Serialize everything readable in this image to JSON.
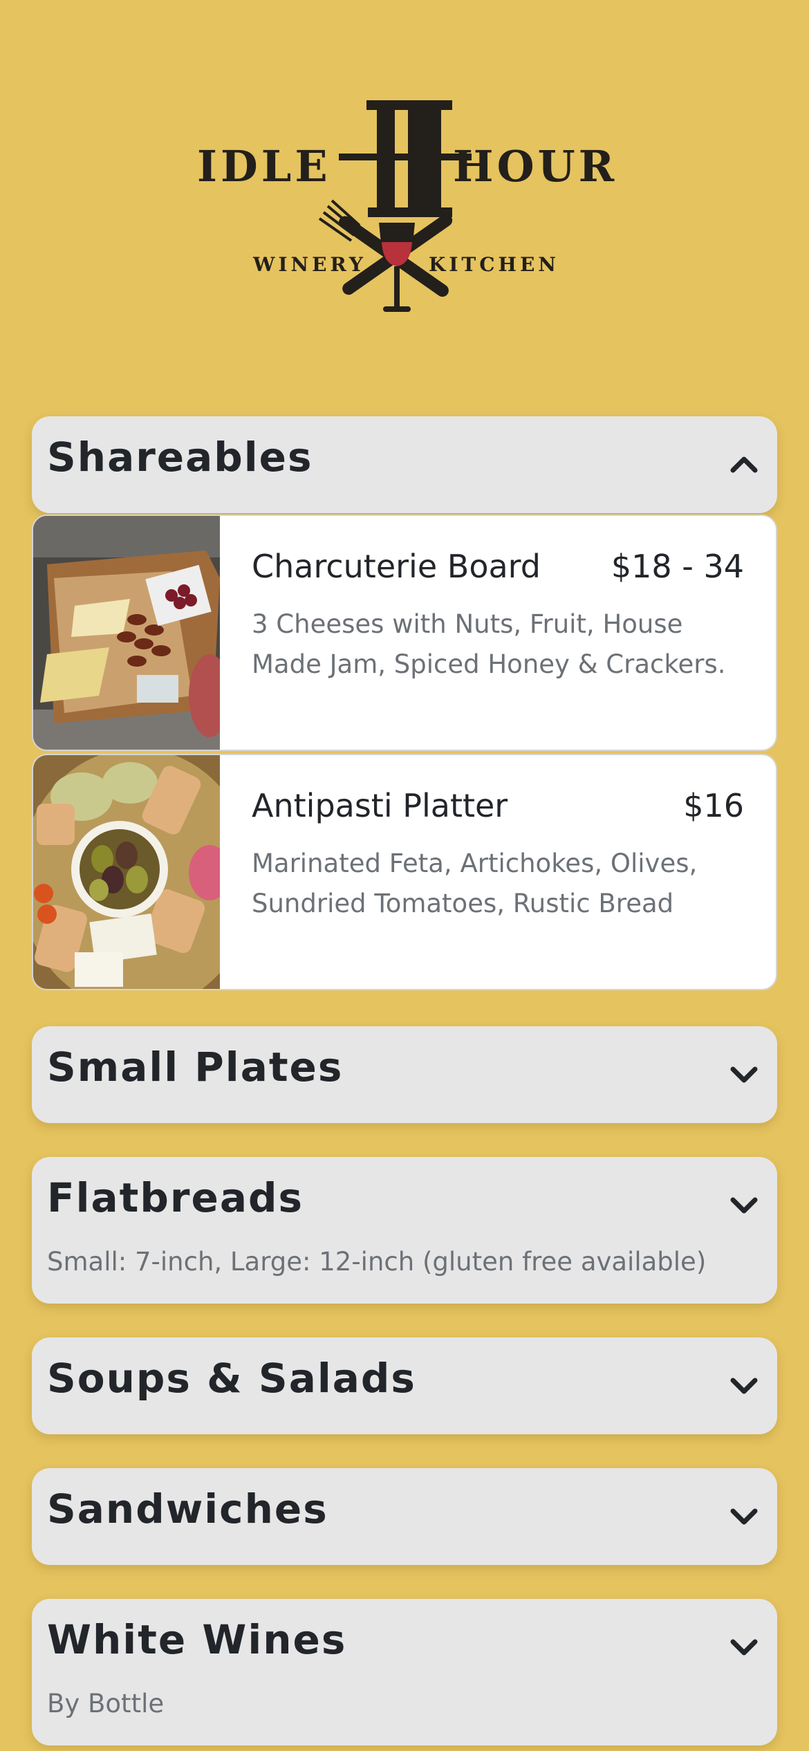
{
  "brand": {
    "word_left": "IDLE",
    "word_right": "HOUR",
    "sub_left": "WINERY",
    "sub_right": "KITCHEN",
    "monogram": "IH"
  },
  "colors": {
    "background": "#e5c35f",
    "section_bg": "#e6e6e6",
    "card_bg": "#ffffff",
    "title_text": "#22252a",
    "muted_text": "#6c7177",
    "logo_dark": "#231f1b",
    "wine_red": "#b8323b"
  },
  "sections": [
    {
      "title": "Shareables",
      "subtitle": "",
      "icon": "chevron-up-icon",
      "expanded": true,
      "items": [
        {
          "name": "Charcuterie Board",
          "price": "$18 - 34",
          "description": "3 Cheeses with Nuts, Fruit, House Made Jam, Spiced Honey & Crackers.",
          "image": "charcuterie-board-photo"
        },
        {
          "name": "Antipasti Platter",
          "price": "$16",
          "description": "Marinated Feta, Artichokes, Olives, Sundried Tomatoes, Rustic Bread",
          "image": "antipasti-platter-photo"
        }
      ]
    },
    {
      "title": "Small Plates",
      "subtitle": "",
      "icon": "chevron-down-icon",
      "expanded": false
    },
    {
      "title": "Flatbreads",
      "subtitle": "Small: 7-inch, Large: 12-inch (gluten free available)",
      "icon": "chevron-down-icon",
      "expanded": false
    },
    {
      "title": "Soups & Salads",
      "subtitle": "",
      "icon": "chevron-down-icon",
      "expanded": false
    },
    {
      "title": "Sandwiches",
      "subtitle": "",
      "icon": "chevron-down-icon",
      "expanded": false
    },
    {
      "title": "White Wines",
      "subtitle": "By Bottle",
      "icon": "chevron-down-icon",
      "expanded": false
    }
  ]
}
